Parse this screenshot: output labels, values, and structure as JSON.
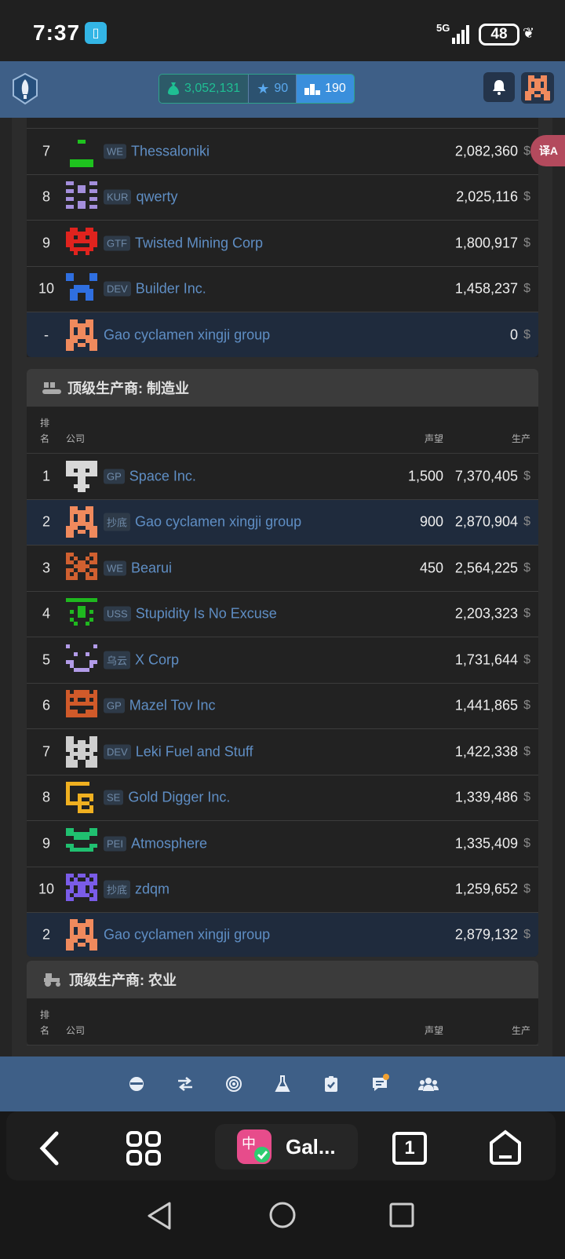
{
  "status_bar": {
    "time": "7:37",
    "network": "5G",
    "battery": "48"
  },
  "app_bar": {
    "money": "3,052,131",
    "stars": "90",
    "rank": "190",
    "icons": [
      "rocket-logo-icon",
      "money-bag-icon",
      "star-icon",
      "podium-icon",
      "bell-icon",
      "avatar-icon"
    ]
  },
  "translate_fab": {
    "label": "译A"
  },
  "top_list": {
    "rows": [
      {
        "rank": "7",
        "tag": "WE",
        "name": "Thessaloniki",
        "value": "2,082,360",
        "currency": "$"
      },
      {
        "rank": "8",
        "tag": "KUR",
        "name": "qwerty",
        "value": "2,025,116",
        "currency": "$"
      },
      {
        "rank": "9",
        "tag": "GTF",
        "name": "Twisted Mining Corp",
        "value": "1,800,917",
        "currency": "$"
      },
      {
        "rank": "10",
        "tag": "DEV",
        "name": "Builder Inc.",
        "value": "1,458,237",
        "currency": "$"
      }
    ],
    "me": {
      "rank": "-",
      "name": "Gao cyclamen xingji group",
      "value": "0",
      "currency": "$"
    }
  },
  "manufacturing": {
    "title": "顶级生产商: 制造业",
    "header": {
      "rank_line1": "排",
      "rank_line2": "名",
      "company": "公司",
      "prestige": "声望",
      "production": "生产"
    },
    "rows": [
      {
        "rank": "1",
        "tag": "GP",
        "name": "Space Inc.",
        "prestige": "1,500",
        "value": "7,370,405",
        "currency": "$"
      },
      {
        "rank": "2",
        "tag": "抄底",
        "name": "Gao cyclamen xingji group",
        "prestige": "900",
        "value": "2,870,904",
        "currency": "$"
      },
      {
        "rank": "3",
        "tag": "WE",
        "name": "Bearui",
        "prestige": "450",
        "value": "2,564,225",
        "currency": "$"
      },
      {
        "rank": "4",
        "tag": "USS",
        "name": "Stupidity Is No Excuse",
        "prestige": "",
        "value": "2,203,323",
        "currency": "$"
      },
      {
        "rank": "5",
        "tag": "乌云",
        "name": "X Corp",
        "prestige": "",
        "value": "1,731,644",
        "currency": "$"
      },
      {
        "rank": "6",
        "tag": "GP",
        "name": "Mazel Tov Inc",
        "prestige": "",
        "value": "1,441,865",
        "currency": "$"
      },
      {
        "rank": "7",
        "tag": "DEV",
        "name": "Leki Fuel and Stuff",
        "prestige": "",
        "value": "1,422,338",
        "currency": "$"
      },
      {
        "rank": "8",
        "tag": "SE",
        "name": "Gold Digger Inc.",
        "prestige": "",
        "value": "1,339,486",
        "currency": "$"
      },
      {
        "rank": "9",
        "tag": "PEI",
        "name": "Atmosphere",
        "prestige": "",
        "value": "1,335,409",
        "currency": "$"
      },
      {
        "rank": "10",
        "tag": "抄底",
        "name": "zdqm",
        "prestige": "",
        "value": "1,259,652",
        "currency": "$"
      }
    ],
    "me": {
      "rank": "2",
      "name": "Gao cyclamen xingji group",
      "value": "2,879,132",
      "currency": "$"
    }
  },
  "agriculture": {
    "title": "顶级生产商: 农业",
    "header": {
      "rank_line1": "排",
      "rank_line2": "名",
      "company": "公司",
      "prestige": "声望",
      "production": "生产"
    }
  },
  "bottom_nav": [
    "planet-icon",
    "transfer-icon",
    "radar-icon",
    "flask-icon",
    "clipboard-check-icon",
    "chat-icon",
    "users-icon"
  ],
  "browser_bar": {
    "tab_title": "Gal...",
    "tab_count": "1"
  }
}
